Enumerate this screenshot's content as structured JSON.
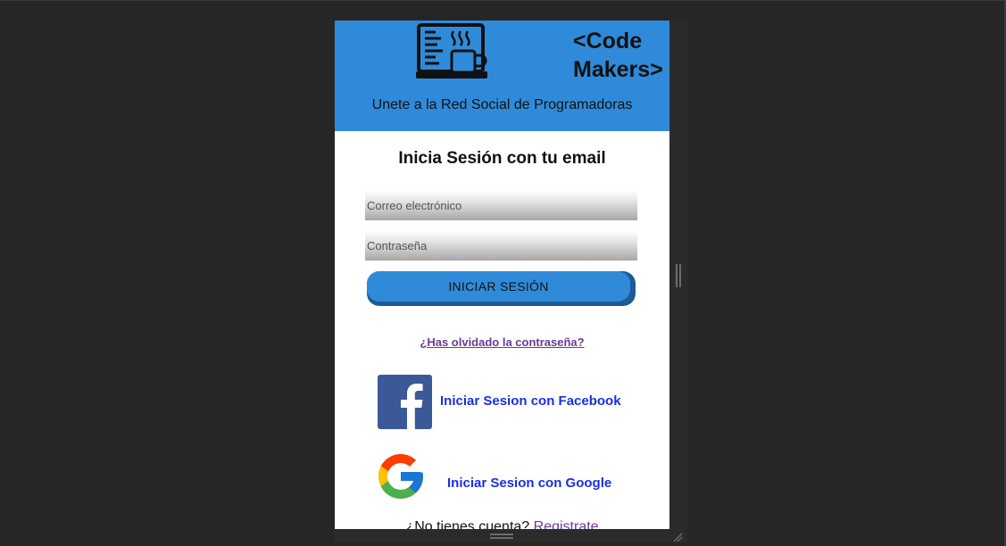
{
  "header": {
    "logo_text_line1": "<Code",
    "logo_text_line2": "Makers>",
    "tagline": "Unete a la Red Social de Programadoras",
    "background_color": "#2f8bd9"
  },
  "login_form": {
    "title": "Inicia Sesión con tu email",
    "email_placeholder": "Correo electrónico",
    "password_placeholder": "Contraseña",
    "submit_label": "INICIAR SESIÓN",
    "forgot_password_link": "¿Has olvidado la contraseña?"
  },
  "social_login": {
    "facebook_label": "Iniciar Sesion con Facebook",
    "facebook_icon": "facebook-icon",
    "google_label": "Iniciar Sesion con Google",
    "google_icon": "google-icon",
    "label_color": "#1a2fe6"
  },
  "register": {
    "prompt": "¿No tienes cuenta?",
    "link_label": "Registrate",
    "link_color": "#6a3a9a"
  }
}
